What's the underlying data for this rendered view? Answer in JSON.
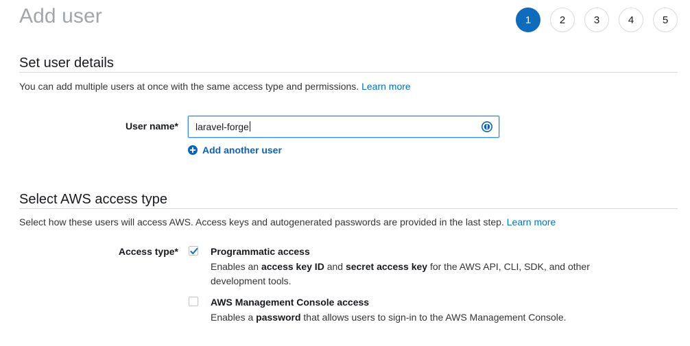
{
  "header": {
    "title": "Add user",
    "steps": [
      {
        "number": "1",
        "active": true
      },
      {
        "number": "2",
        "active": false
      },
      {
        "number": "3",
        "active": false
      },
      {
        "number": "4",
        "active": false
      },
      {
        "number": "5",
        "active": false
      }
    ]
  },
  "colors": {
    "accent": "#0f6cbd",
    "link": "#0073bb",
    "title_gray": "#a1a6ab",
    "text": "#16191f",
    "rule": "#d8d8d8",
    "focus_border": "#3d8fd5",
    "checkbox_border": "#bcc3c7"
  },
  "user_details": {
    "heading": "Set user details",
    "description": "You can add multiple users at once with the same access type and permissions.",
    "learn_more": "Learn more",
    "username_label": "User name*",
    "username_value": "laravel-forge",
    "username_placeholder": "",
    "info_icon": "info-circle-icon",
    "add_another_label": "Add another user",
    "add_another_icon": "plus-circle-icon"
  },
  "access_type": {
    "heading": "Select AWS access type",
    "description": "Select how these users will access AWS. Access keys and autogenerated passwords are provided in the last step.",
    "learn_more": "Learn more",
    "label": "Access type*",
    "options": [
      {
        "title": "Programmatic access",
        "checked": true,
        "desc_parts": [
          {
            "text": "Enables an ",
            "bold": false
          },
          {
            "text": "access key ID",
            "bold": true
          },
          {
            "text": " and ",
            "bold": false
          },
          {
            "text": "secret access key",
            "bold": true
          },
          {
            "text": " for the AWS API, CLI, SDK, and other development tools.",
            "bold": false
          }
        ],
        "desc_line1": "Enables an access key ID and secret access key for the AWS API, CLI, SDK, and",
        "desc_line2": "other development tools."
      },
      {
        "title": "AWS Management Console access",
        "checked": false,
        "desc_parts": [
          {
            "text": "Enables a ",
            "bold": false
          },
          {
            "text": "password",
            "bold": true
          },
          {
            "text": " that allows users to sign-in to the AWS Management Console.",
            "bold": false
          }
        ],
        "desc_line1": "Enables a password that allows users to sign-in to the AWS Management Console.",
        "desc_line2": ""
      }
    ]
  }
}
